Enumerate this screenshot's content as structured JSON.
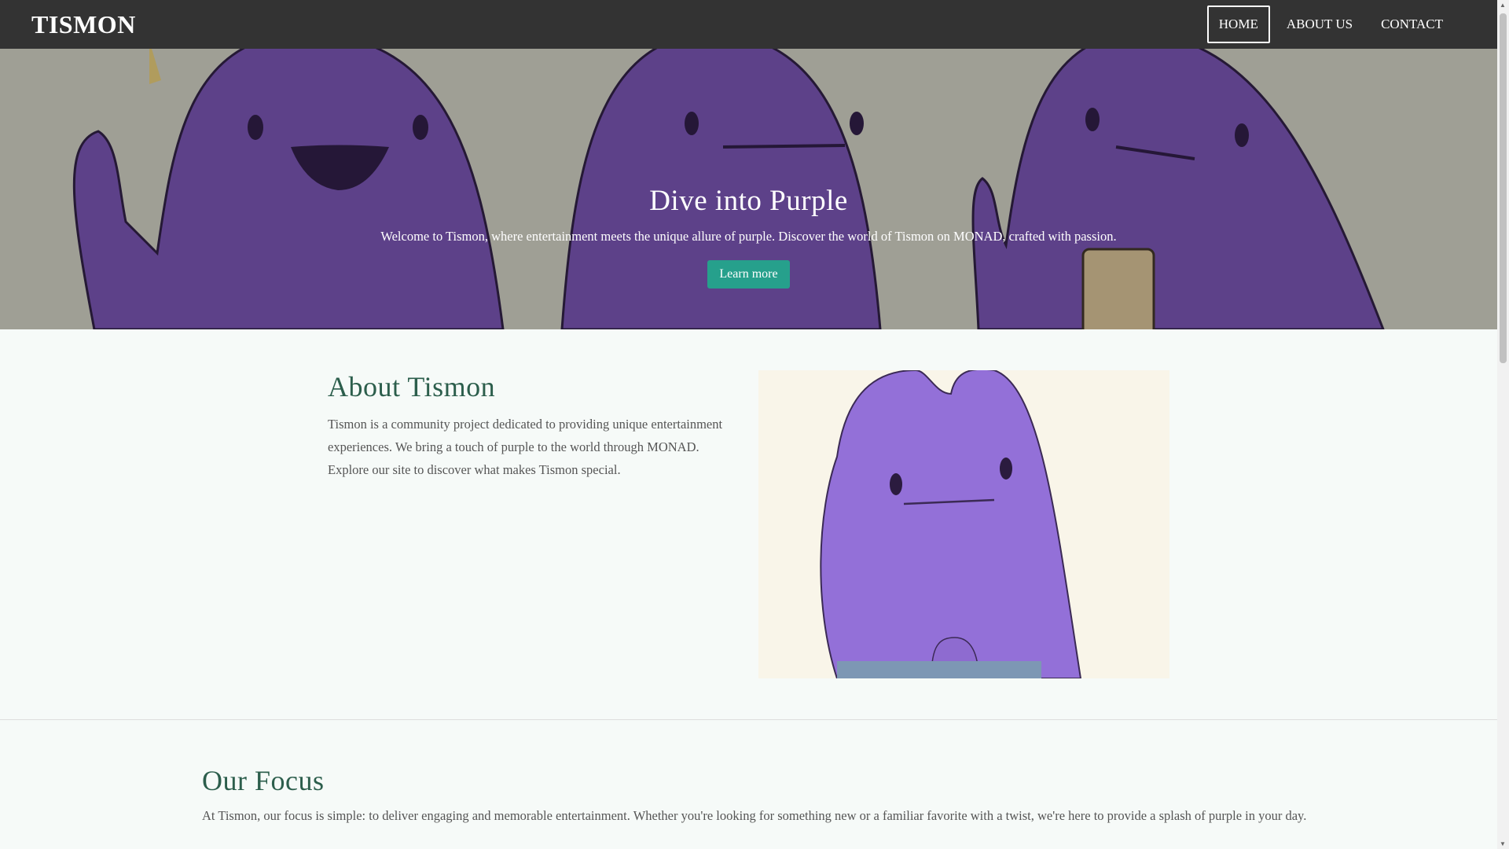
{
  "header": {
    "logo": "TISMON",
    "nav": [
      {
        "label": "HOME",
        "active": true
      },
      {
        "label": "ABOUT US"
      },
      {
        "label": "CONTACT"
      }
    ]
  },
  "hero": {
    "title": "Dive into Purple",
    "subtitle": "Welcome to Tismon, where entertainment meets the unique allure of purple. Discover the world of Tismon on MONAD, crafted with passion.",
    "button": "Learn more"
  },
  "about": {
    "title": "About Tismon",
    "text": "Tismon is a community project dedicated to providing unique entertainment experiences. We bring a touch of purple to the world through MONAD. Explore our site to discover what makes Tismon special."
  },
  "focus": {
    "title": "Our Focus",
    "text": "At Tismon, our focus is simple: to deliver engaging and memorable entertainment. Whether you're looking for something new or a familiar favorite with a twist, we're here to provide a splash of purple in your day."
  },
  "colors": {
    "header": "#333333",
    "accent": "#26a08c",
    "heading": "#2c5e4c",
    "purple": "#6e4ba3"
  }
}
